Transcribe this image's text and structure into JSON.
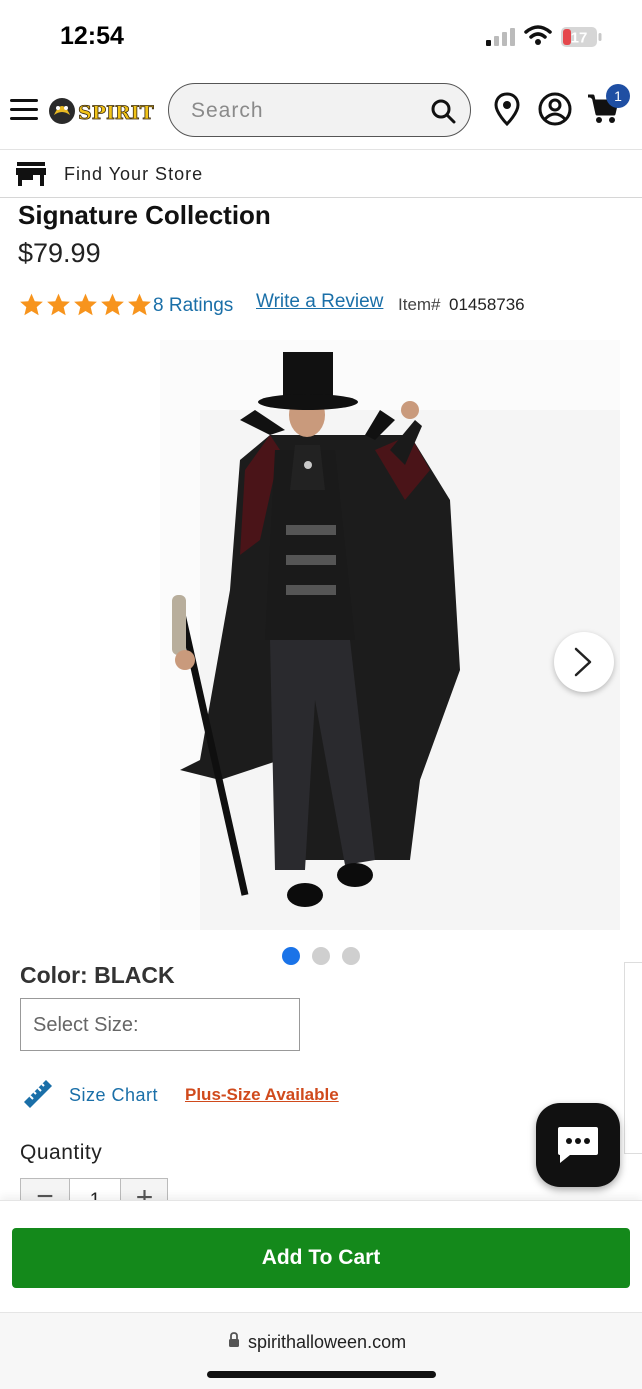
{
  "status_bar": {
    "time": "12:54",
    "battery_level": "17",
    "icons": [
      "signal-icon",
      "wifi-icon",
      "battery-icon"
    ]
  },
  "header": {
    "logo_text": "SPIRIT",
    "search_placeholder": "Search",
    "cart_count": "1",
    "icons": [
      "hamburger-menu-icon",
      "search-icon",
      "location-pin-icon",
      "account-icon",
      "cart-icon"
    ]
  },
  "find_store": {
    "label": "Find Your Store"
  },
  "product": {
    "title": "Signature Collection",
    "price": "$79.99",
    "rating": 5,
    "ratings_label": "8 Ratings",
    "write_review_label": "Write a Review",
    "item_label": "Item#",
    "item_number": "01458736",
    "image_count": 3,
    "active_image_index": 0,
    "color_label": "Color: BLACK",
    "size_placeholder": "Select Size:",
    "size_chart_label": "Size Chart",
    "plus_size_label": "Plus-Size Available",
    "quantity_label": "Quantity",
    "quantity_value": "1",
    "minus_symbol": "−",
    "plus_symbol": "+"
  },
  "cart": {
    "add_to_cart_label": "Add To Cart"
  },
  "browser": {
    "url": "spirithalloween.com"
  },
  "colors": {
    "accent_blue": "#1a6fa8",
    "add_to_cart_green": "#14891b",
    "star_orange": "#f7941d",
    "plus_size_orange": "#d04a1c",
    "cart_badge_blue": "#1f4fa3",
    "battery_red": "#e5484d"
  }
}
